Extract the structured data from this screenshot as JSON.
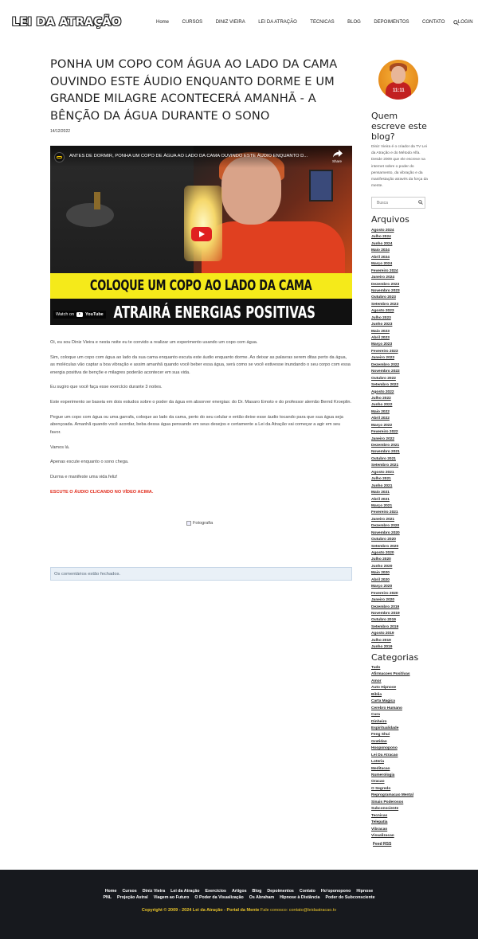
{
  "header": {
    "logo": "LEI DA ATRAÇÃO",
    "nav": [
      "Home",
      "CURSOS",
      "DINIZ VIEIRA",
      "LEI DA ATRAÇÃO",
      "TECNICAS",
      "BLOG",
      "DEPOIMENTOS",
      "CONTATO",
      "LOGIN"
    ]
  },
  "post": {
    "title": "PONHA UM COPO COM ÁGUA AO LADO DA CAMA OUVINDO ESTE ÁUDIO ENQUANTO DORME E UM GRANDE MILAGRE ACONTECERÁ AMANHÃ - A BÊNÇÃO DA ÁGUA DURANTE O SONO",
    "date": "14/12/2022",
    "video": {
      "title": "ANTES DE DORMIR, PONHA UM COPO DE ÁGUA AO LADO DA CAMA OUVINDO ESTE ÁUDIO ENQUANTO D...",
      "share": "Share",
      "banner_line1": "COLOQUE UM COPO AO LADO DA CAMA",
      "banner_line2": "ATRAIRÁ ENERGIAS POSITIVAS",
      "watch_on": "Watch on",
      "youtube": "YouTube"
    },
    "paragraphs": [
      "Oi, eu sou Diniz Vieira e nesta noite eu te convido a realizar um experimento usando um copo com água.",
      "Sim, coloque um copo com água ao lado da sua cama enquanto escuta este áudio enquanto dorme. Ao deixar as palavras serem ditas perto da água, as moléculas vão captar a boa vibração e assim amanhã quando você beber essa água, será como se você estivesse inundando o seu corpo com essa energia positiva de bençõe e milagres poderão acontecer em sua vida.",
      "Eu sugiro que você faça esse exercício durante 3 noites.",
      "Este experimento se baseia em dois estudos sobre o poder da água em absorver energias: do Dr. Masaro Emoto e do professor alemão Bernd Kroeplin.",
      "Pegue um copo com água ou uma garrafa, coloque ao lado da cama, perto do seu celular e então deixe esse áudio tocando para que sua água seja abençoada. Amanhã quando você acordar, beba dessa água pensando em seus desejos e certamente a Lei da Atração vai começar a agir em seu favor.",
      "Vamos lá.",
      "Apenas escute enquanto o sono chega.",
      "Durma e manifeste uma vida feliz!"
    ],
    "cta": "ESCUTE O ÁUDIO CLICANDO NO VÍDEO ACIMA.",
    "image_alt": "Fotografia",
    "comments_closed": "Os comentários estão fechados."
  },
  "sidebar": {
    "who_title": "Quem escreve este blog?",
    "bio": "Diniz Vieira é o criador da TV Lei da Atração e do Método Alfa. Desde 2009 que ele escreve na internet sobre o poder do pensamento, da vibração e da manifestação através da força da mente.",
    "avatar_text": "11:11",
    "search_placeholder": "Busca",
    "archives_title": "Arquivos",
    "archives": [
      "Agosto 2024",
      "Julho 2024",
      "Junho 2024",
      "Maio 2024",
      "Abril 2024",
      "Março 2024",
      "Fevereiro 2024",
      "Janeiro 2024",
      "Dezembro 2023",
      "Novembro 2023",
      "Outubro 2023",
      "Setembro 2023",
      "Agosto 2023",
      "Julho 2023",
      "Junho 2023",
      "Maio 2023",
      "Abril 2023",
      "Março 2023",
      "Fevereiro 2023",
      "Janeiro 2023",
      "Dezembro 2022",
      "Novembro 2022",
      "Outubro 2022",
      "Setembro 2022",
      "Agosto 2022",
      "Julho 2022",
      "Junho 2022",
      "Maio 2022",
      "Abril 2022",
      "Março 2022",
      "Fevereiro 2022",
      "Janeiro 2022",
      "Dezembro 2021",
      "Novembro 2021",
      "Outubro 2021",
      "Setembro 2021",
      "Agosto 2021",
      "Julho 2021",
      "Junho 2021",
      "Maio 2021",
      "Abril 2021",
      "Março 2021",
      "Fevereiro 2021",
      "Janeiro 2021",
      "Dezembro 2020",
      "Novembro 2020",
      "Outubro 2020",
      "Setembro 2020",
      "Agosto 2020",
      "Julho 2020",
      "Junho 2020",
      "Maio 2020",
      "Abril 2020",
      "Março 2020",
      "Fevereiro 2020",
      "Janeiro 2020",
      "Dezembro 2019",
      "Novembro 2019",
      "Outubro 2019",
      "Setembro 2019",
      "Agosto 2019",
      "Julho 2019",
      "Junho 2019"
    ],
    "categories_title": "Categorias",
    "categories": [
      "Tudo",
      "Afirmacoes Positivas",
      "Amor",
      "Auto Hipnose",
      "Biblia",
      "Carta Magica",
      "Cerebro Humano",
      "Cura",
      "Dinheiro",
      "Espiritualidade",
      "Feng Shui",
      "Gratidao",
      "Hooponopono",
      "Lei Da Atracao",
      "Loteria",
      "Meditacao",
      "Numerologia",
      "Oracao",
      "O Segredo",
      "Reprogramacao Mental",
      "Sinais Poderosos",
      "Subconsciente",
      "Tecnicas",
      "Telepatia",
      "Vibracao",
      "Visualizacao"
    ],
    "feed": "Feed RSS"
  },
  "footer": {
    "row1": [
      "Home",
      "Cursos",
      "Diniz Vieira",
      "Lei da Atração",
      "Exercícios",
      "Artigos",
      "Blog",
      "Depoimentos",
      "Contato",
      "Ho'oponopono",
      "Hipnose"
    ],
    "row2": [
      "PNL",
      "Projeção Astral",
      "Viagem ao Futuro",
      "O Poder da Visualização",
      "Os Abraham",
      "Hipnose à Distância",
      "Poder do Subconsciente"
    ],
    "copyright_bold": "Copyright © 2009 - 2024 Lei da Atração - Portal da Mente",
    "copyright_rest": " Fale conosco: contato@leidaatracao.tv"
  },
  "colors": {
    "accent_red": "#e02a1a",
    "banner_yellow": "#f5ea1a",
    "footer_bg": "#17191e",
    "footer_copyright": "#e8c32a"
  }
}
